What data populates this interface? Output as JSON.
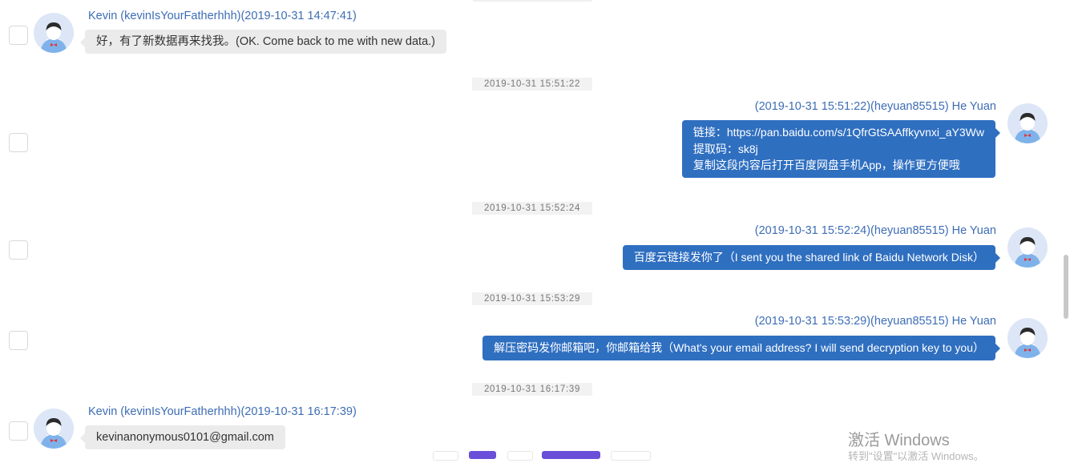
{
  "messages": [
    {
      "sender": "Kevin (kevinIsYourFatherhhh)(2019-10-31 14:47:41)",
      "lines": [
        "好，有了新数据再来找我。(OK. Come back to me with new data.)"
      ]
    },
    {
      "separator": "2019-10-31 15:51:22",
      "sender": "(2019-10-31 15:51:22)(heyuan85515) He Yuan",
      "lines": [
        "链接：https://pan.baidu.com/s/1QfrGtSAAffkyvnxi_aY3Ww",
        "提取码：sk8j",
        "复制这段内容后打开百度网盘手机App，操作更方便哦"
      ]
    },
    {
      "separator": "2019-10-31 15:52:24",
      "sender": "(2019-10-31 15:52:24)(heyuan85515) He Yuan",
      "lines": [
        "百度云链接发你了（I sent you the shared link of Baidu Network Disk）"
      ]
    },
    {
      "separator": "2019-10-31 15:53:29",
      "sender": "(2019-10-31 15:53:29)(heyuan85515) He Yuan",
      "lines": [
        "解压密码发你邮箱吧，你邮箱给我（What's your email address? I will send decryption key to you）"
      ]
    },
    {
      "separator": "2019-10-31 16:17:39",
      "sender": "Kevin (kevinIsYourFatherhhh)(2019-10-31 16:17:39)",
      "lines": [
        "kevinanonymous0101@gmail.com"
      ]
    }
  ],
  "watermark": {
    "title": "激活 Windows",
    "subtitle": "转到\"设置\"以激活 Windows。"
  },
  "colors": {
    "outgoing_bubble": "#2f6fc0",
    "incoming_bubble": "#ebebeb",
    "sender_name": "#3d6db5",
    "avatar_bg": "#dce6f6",
    "toolbar_accent": "#6a4fd8"
  },
  "icons": {
    "avatar": "user-avatar-icon",
    "checkbox": "select-checkbox"
  }
}
